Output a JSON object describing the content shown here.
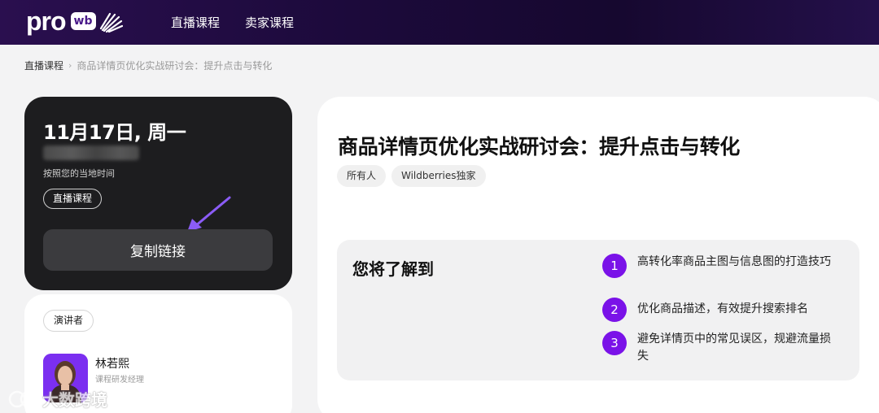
{
  "header": {
    "logo_text": "pro",
    "logo_badge": "wb",
    "nav": [
      {
        "label": "直播课程"
      },
      {
        "label": "卖家课程"
      }
    ]
  },
  "breadcrumb": {
    "root": "直播课程",
    "separator": "›",
    "current": "商品详情页优化实战研讨会：提升点击与转化"
  },
  "date_card": {
    "date": "11月17日, 周一",
    "timezone_note": "按照您的当地时间",
    "badge": "直播课程",
    "copy_button": "复制链接"
  },
  "speaker_card": {
    "badge": "演讲者",
    "name": "林若熙",
    "role": "课程研发经理"
  },
  "main": {
    "title": "商品详情页优化实战研讨会：提升点击与转化",
    "tags": [
      "所有人",
      "Wildberries独家"
    ],
    "learn": {
      "title": "您将了解到",
      "items": [
        {
          "num": "1",
          "text": "高转化率商品主图与信息图的打造技巧"
        },
        {
          "num": "2",
          "text": "优化商品描述，有效提升搜索排名"
        },
        {
          "num": "3",
          "text": "避免详情页中的常见误区，规避流量损失"
        }
      ]
    }
  },
  "watermark": "大数跨境",
  "colors": {
    "accent": "#7a12e8",
    "header_bg": "#1c0a3b",
    "dark_card": "#1d1d1f"
  }
}
